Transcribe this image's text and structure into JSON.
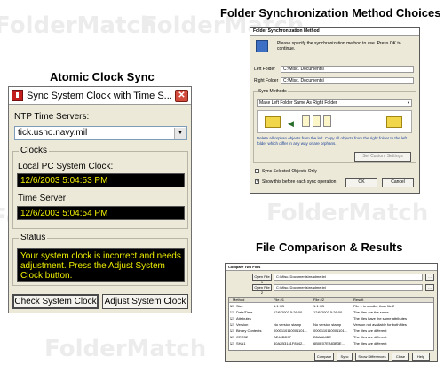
{
  "watermark": "FolderMatch",
  "headings": {
    "clock": "Atomic Clock Sync",
    "sync": "Folder Synchronization Method Choices",
    "compare": "File Comparison & Results"
  },
  "clock": {
    "title": "Sync System Clock with Time S...",
    "close_glyph": "✕",
    "ntp_label": "NTP Time Servers:",
    "ntp_value": "tick.usno.navy.mil",
    "clocks_group": "Clocks",
    "local_label": "Local PC System Clock:",
    "local_value": "12/6/2003 5:04:53 PM",
    "server_label": "Time Server:",
    "server_value": "12/6/2003 5:04:54 PM",
    "status_group": "Status",
    "status_text": "Your system clock is incorrect and needs adjustment.  Press the Adjust System Clock button.",
    "check_button": "Check System Clock",
    "adjust_button": "Adjust System Clock",
    "status_color": "#f0f000"
  },
  "sync": {
    "title": "Folder Synchronization Method",
    "intro": "Please specify the synchronization method to use. Press OK to continue.",
    "left_label": "Left Folder",
    "left_value": "C:\\Misc. Documents\\",
    "right_label": "Right Folder",
    "right_value": "C:\\Misc. Documents\\",
    "methods_group": "Sync Methods",
    "method_value": "Make Left Folder Same As Right Folder",
    "description": "Delete all orphan objects from the left. Copy all objects from the right folder to the left folder which differ in any way or are orphans.",
    "custom_button": "Set Custom Settings",
    "selected_only": "Sync Selected Objects Only",
    "show_before": "Show this before each sync operation",
    "ok_button": "OK",
    "cancel_button": "Cancel"
  },
  "compare": {
    "title": "Compare Two Files",
    "open_file1": "Open File 1",
    "file1_value": "C:\\Misc. Documents\\readme.txt",
    "open_file2": "Open File 2",
    "file2_value": "C:\\Misc. Documents\\readme.txt",
    "columns": [
      "Method",
      "File #1",
      "File #2",
      "Result"
    ],
    "rows": [
      [
        "Size",
        "1.1 KB",
        "1.1 KB",
        "File 1 is smaller than file 2"
      ],
      [
        "Date/Time",
        "12/6/2003 5:26:00 ...",
        "12/6/2003 5:26:00 ...",
        "The files are the same"
      ],
      [
        "Attributes",
        "",
        "",
        "The files have the same attributes"
      ],
      [
        "Version",
        "No version stamp",
        "No version stamp",
        "Version not available for both files"
      ],
      [
        "Binary Contents",
        "0000110110001101...",
        "0000110110001101...",
        "The files are different"
      ],
      [
        "CRC32",
        "AE44BD97",
        "B5A8A4BE",
        "The files are different"
      ],
      [
        "SHA1",
        "40A2B3141F8342...",
        "6B0E07EB83B3E...",
        "The files are different"
      ]
    ],
    "compare_button": "Compare",
    "sync_button": "Sync",
    "show_diff_button": "Show Differences",
    "close_button": "Close",
    "help_button": "Help"
  }
}
